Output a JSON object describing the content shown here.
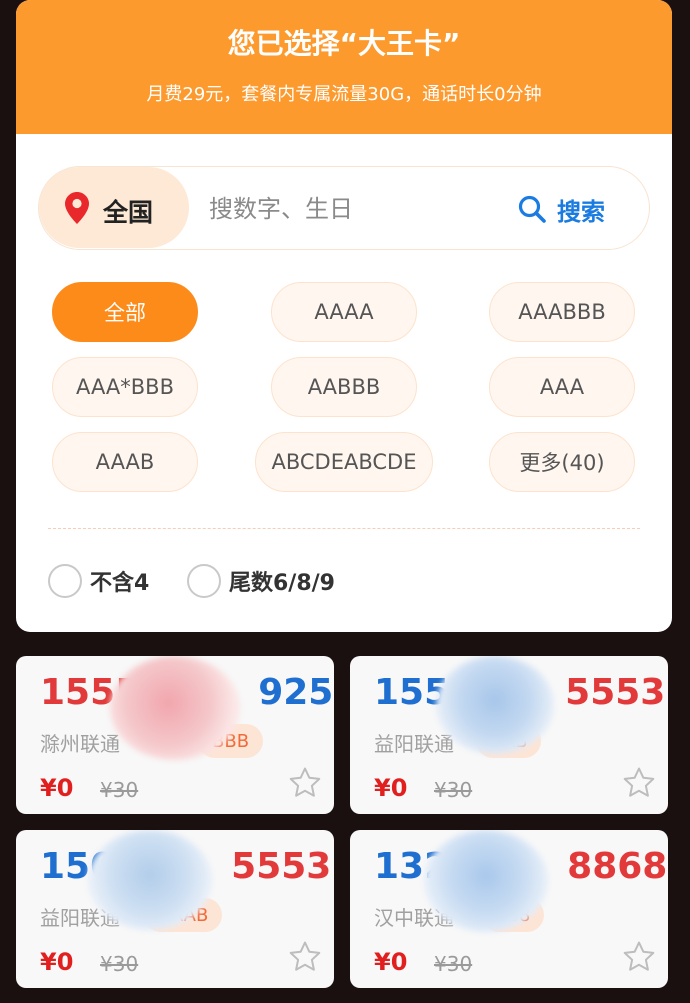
{
  "banner": {
    "title": "您已选择“大王卡”",
    "subtitle": "月费29元，套餐内专属流量30G，通话时长0分钟"
  },
  "search": {
    "region": "全国",
    "placeholder": "搜数字、生日",
    "button_label": "搜索"
  },
  "tags": [
    "全部",
    "AAAA",
    "AAABBB",
    "AAA*BBB",
    "AABBB",
    "AAA",
    "AAAB",
    "ABCDEABCDE",
    "更多(40)"
  ],
  "filters": {
    "exclude_four": "不含4",
    "tail_digits": "尾数6/8/9"
  },
  "cards": [
    {
      "num_start": "1555",
      "num_end": "925",
      "carrier": "滁州联通",
      "tag": "BBB",
      "price": "¥0",
      "old_price": "¥30"
    },
    {
      "num_start": "155",
      "num_end": "5553",
      "carrier": "益阳联通",
      "tag": "AAB",
      "price": "¥0",
      "old_price": "¥30"
    },
    {
      "num_start": "150",
      "num_end": "5553",
      "carrier": "益阳联通",
      "tag": "AAAB",
      "price": "¥0",
      "old_price": "¥30"
    },
    {
      "num_start": "132",
      "num_end": "8868",
      "carrier": "汉中联通",
      "tag": "688",
      "price": "¥0",
      "old_price": "¥30"
    }
  ],
  "colors": {
    "brand_orange": "#fd9a2e",
    "active_tag": "#fd8b1a",
    "link_blue": "#1a7be0",
    "number_blue": "#1f6fd0",
    "number_red": "#e23a3a",
    "price_red": "#e21f1f"
  },
  "icons": {
    "region": "map-pin-icon",
    "search": "search-icon",
    "favorite": "star-outline-icon"
  }
}
